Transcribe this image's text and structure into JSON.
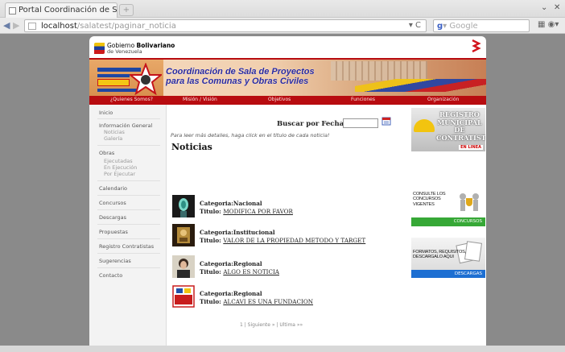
{
  "browser": {
    "tab_title": "Portal Coordinación de Sala ...",
    "new_tab": "+",
    "url_host": "localhost",
    "url_path": "/salatest/paginar_noticia",
    "search_placeholder": "Google",
    "back": "◀",
    "forward": "▶",
    "min": "⌄",
    "close": "✕"
  },
  "site": {
    "gov_line1_normal": "Gobierno ",
    "gov_line1_bold": "Bolivariano",
    "gov_line2": "de Venezuela",
    "banner_title_line1": "Coordinación de Sala de Proyectos",
    "banner_title_line2": "para las Comunas y Obras Civiles",
    "menu": [
      "¿Quienes Somos?",
      "Misión / Visión",
      "Objetivos",
      "Funciones",
      "Organización"
    ]
  },
  "sidebar": {
    "items": [
      {
        "label": "Inicio"
      },
      {
        "label": "Información General"
      },
      {
        "label": "Noticias",
        "sub": true
      },
      {
        "label": "Galería",
        "sub": true
      },
      {
        "label": "Obras"
      },
      {
        "label": "Ejecutadas",
        "sub": true
      },
      {
        "label": "En Ejecución",
        "sub": true
      },
      {
        "label": "Por Ejecutar",
        "sub": true
      },
      {
        "label": "Calendario"
      },
      {
        "label": "Concursos"
      },
      {
        "label": "Descargas"
      },
      {
        "label": "Propuestas"
      },
      {
        "label": "Registro Contratistas"
      },
      {
        "label": "Sugerencias"
      },
      {
        "label": "Contacto"
      }
    ]
  },
  "main": {
    "search_label": "Buscar por Fecha:",
    "hint": "Para leer más detalles, haga click en el titulo de cada noticia!",
    "heading": "Noticias",
    "category_prefix": "Categoria:",
    "title_prefix": "Titulo: ",
    "news": [
      {
        "category": "Nacional",
        "title": "MODIFICA POR FAVOR"
      },
      {
        "category": "Institucional",
        "title": "VALOR DE LA PROPIEDAD METODO Y TARGET"
      },
      {
        "category": "Regional",
        "title": "ALGO ES NOTICIA"
      },
      {
        "category": "Regional",
        "title": "ALCAVI ES UNA FUNDACION"
      }
    ],
    "pager": "1 | Siguiente » | Ultima »»"
  },
  "right": {
    "ad1_text": "REGISTRO MUNICIPAL DE CONTRATISTAS",
    "ad1_badge": "EN LINEA",
    "ad2_text": "CONSULTE LOS CONCURSOS VIGENTES",
    "ad2_bar": "CONCURSOS",
    "ad3_text": "FORMATOS, REQUISITOS, DESCARGALO AQUI",
    "ad3_bar": "DESCARGAS"
  }
}
